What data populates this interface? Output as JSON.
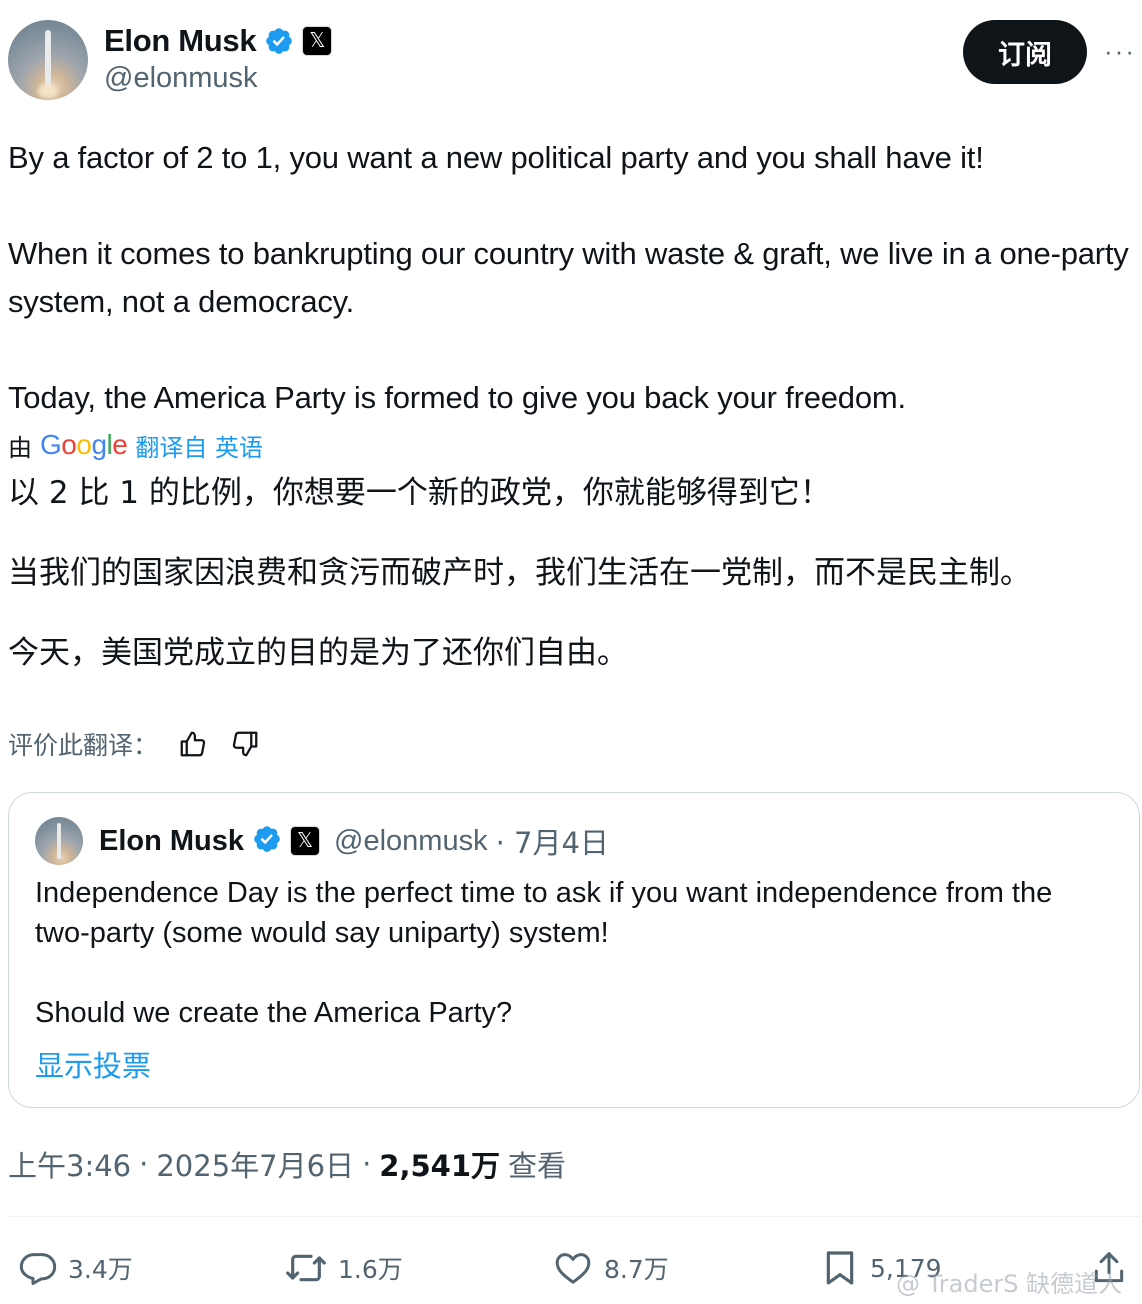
{
  "author": {
    "name": "Elon Musk",
    "handle": "@elonmusk"
  },
  "header": {
    "subscribe_label": "订阅",
    "more_label": "···"
  },
  "tweet": {
    "paragraphs": [
      "By a factor of 2 to 1, you want a new political party and you shall have it!",
      "When it comes to bankrupting our country with waste & graft, we live in a one-party system, not a democracy.",
      "Today, the America Party is formed to give you back your freedom."
    ]
  },
  "translation": {
    "by_label": "由",
    "google_letters": [
      "G",
      "o",
      "o",
      "g",
      "l",
      "e"
    ],
    "from_label": "翻译自 英语",
    "paragraphs": [
      "以 2 比 1 的比例，你想要一个新的政党，你就能够得到它！",
      "当我们的国家因浪费和贪污而破产时，我们生活在一党制，而不是民主制。",
      "今天，美国党成立的目的是为了还你们自由。"
    ],
    "rate_label": "评价此翻译："
  },
  "quote": {
    "name": "Elon Musk",
    "handle": "@elonmusk",
    "date": "· 7月4日",
    "paragraphs": [
      "Independence Day is the perfect time to ask if you want independence from the two-party (some would say uniparty) system!",
      "Should we create the America Party?"
    ],
    "poll_link": "显示投票"
  },
  "meta": {
    "time": "上午3:46",
    "sep1": "·",
    "date": "2025年7月6日",
    "sep2": "·",
    "views": "2,541万",
    "views_label": "查看"
  },
  "actions": {
    "replies": "3.4万",
    "reposts": "1.6万",
    "likes": "8.7万",
    "bookmarks": "5,179"
  },
  "watermark": "@ TraderS 缺德道人",
  "colors": {
    "text": "#0f1419",
    "secondary": "#536471",
    "link": "#1d9bf0",
    "verified": "#1d9bf0",
    "border": "#cfd9de"
  },
  "icons": [
    "verified-badge-icon",
    "x-affiliate-icon",
    "more-icon",
    "thumbs-up-icon",
    "thumbs-down-icon",
    "reply-icon",
    "repost-icon",
    "like-icon",
    "bookmark-icon",
    "share-icon"
  ]
}
